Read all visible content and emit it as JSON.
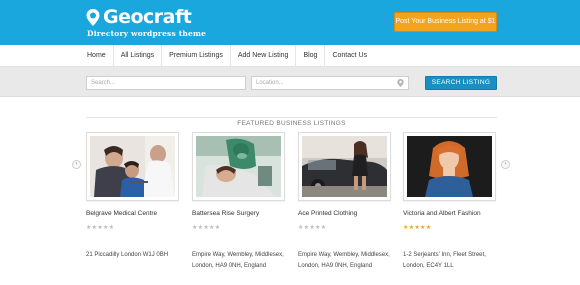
{
  "header": {
    "logo_text": "Geocraft",
    "tagline": "Directory wordpress theme",
    "post_button": "Post Your Business Listing at $1",
    "colors": {
      "header_bg": "#1aa7de",
      "button_bg": "#f3a41f"
    }
  },
  "nav": {
    "items": [
      "Home",
      "All Listings",
      "Premium Listings",
      "Add New Listing",
      "Blog",
      "Contact Us"
    ]
  },
  "search": {
    "search_placeholder": "Search...",
    "location_placeholder": "Location...",
    "button_label": "SEARCH LISTING",
    "button_color": "#1a8fc4"
  },
  "featured": {
    "title": "FEATURED BUSINESS LISTINGS",
    "listings": [
      {
        "name": "Belgrave Medical Centre",
        "rating": "★★★★★",
        "rated": false,
        "address": "21 Piccadilly London W1J 0BH"
      },
      {
        "name": "Battersea Rise Surgery",
        "rating": "★★★★★",
        "rated": false,
        "address": "Empire Way, Wembley, Middlesex, London, HA9 0NH, England"
      },
      {
        "name": "Ace Printed Clothing",
        "rating": "★★★★★",
        "rated": false,
        "address": "Empire Way, Wembley, Middlesex, London, HA9 0NH, England"
      },
      {
        "name": "Victoria and Albert Fashion",
        "rating": "★★★★★",
        "rated": true,
        "address": "1-2 Serjeants' Inn, Fleet Street, London, EC4Y 1LL"
      }
    ]
  },
  "icons": [
    "location-pin-icon",
    "map-marker-icon",
    "arrow-left-icon",
    "arrow-right-icon",
    "star-icon"
  ]
}
